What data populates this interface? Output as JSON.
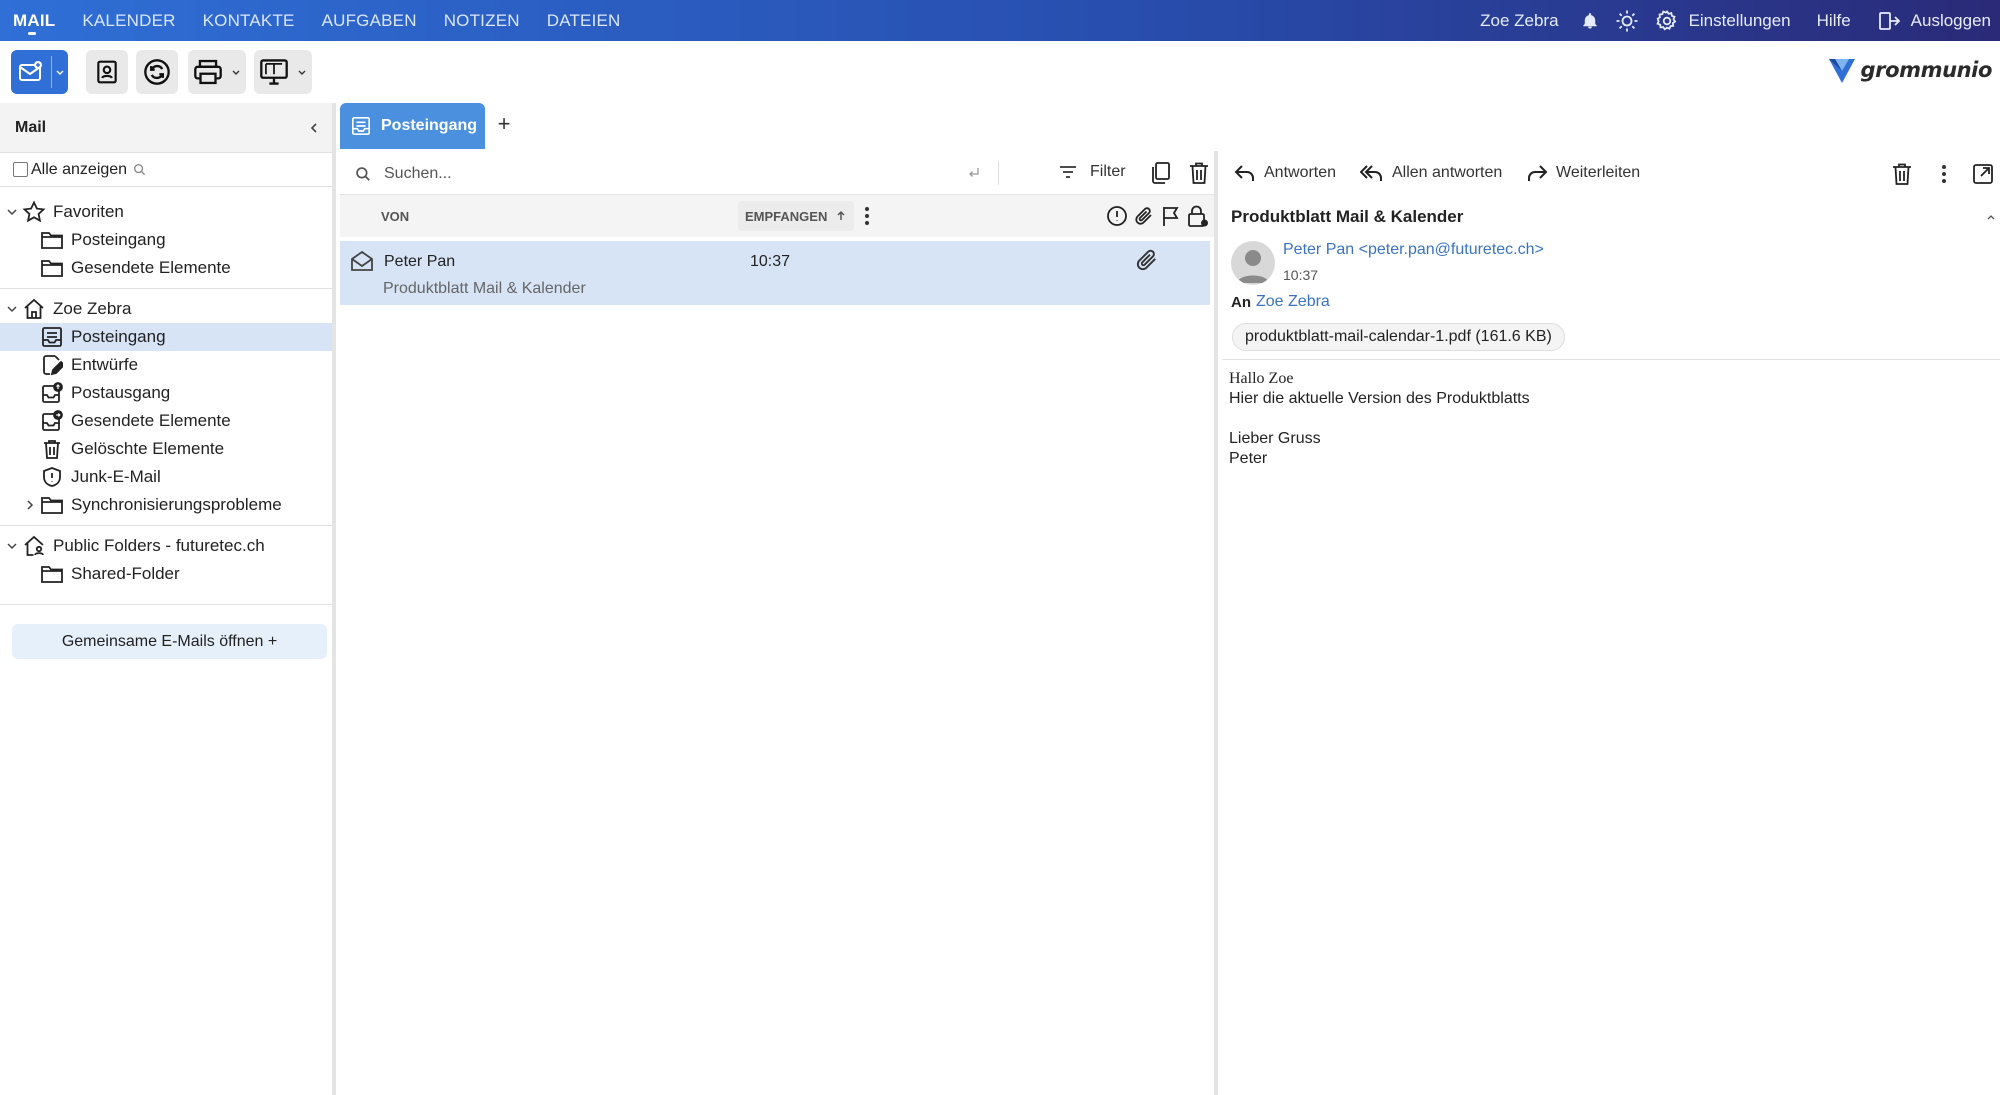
{
  "nav": {
    "items": [
      "MAIL",
      "KALENDER",
      "KONTAKTE",
      "AUFGABEN",
      "NOTIZEN",
      "DATEIEN"
    ],
    "user": "Zoe Zebra",
    "settings": "Einstellungen",
    "help": "Hilfe",
    "logout": "Ausloggen"
  },
  "brand": {
    "logo_text": "grommunio"
  },
  "sidebar": {
    "title": "Mail",
    "show_all": "Alle anzeigen",
    "favorites": {
      "label": "Favoriten",
      "items": [
        "Posteingang",
        "Gesendete Elemente"
      ]
    },
    "mailbox": {
      "label": "Zoe Zebra",
      "items": [
        "Posteingang",
        "Entwürfe",
        "Postausgang",
        "Gesendete Elemente",
        "Gelöschte Elemente",
        "Junk-E-Mail",
        "Synchronisierungsprobleme"
      ]
    },
    "public": {
      "label": "Public Folders - futuretec.ch",
      "items": [
        "Shared-Folder"
      ]
    },
    "shared_button": "Gemeinsame E-Mails öffnen +"
  },
  "tabs": {
    "active": "Posteingang",
    "add": "+"
  },
  "list": {
    "search_placeholder": "Suchen...",
    "filter": "Filter",
    "col_from": "VON",
    "col_received": "EMPFANGEN",
    "messages": [
      {
        "from": "Peter Pan",
        "subject": "Produktblatt Mail & Kalender",
        "time": "10:37"
      }
    ]
  },
  "reader": {
    "reply": "Antworten",
    "reply_all": "Allen antworten",
    "forward": "Weiterleiten",
    "subject": "Produktblatt Mail & Kalender",
    "sender": "Peter Pan <peter.pan@futuretec.ch>",
    "time": "10:37",
    "to_label": "An",
    "to": "Zoe Zebra",
    "attachment": "produktblatt-mail-calendar-1.pdf (161.6 KB)",
    "body": [
      "Hallo Zoe",
      "Hier die aktuelle Version des Produktblatts",
      "Lieber Gruss",
      "Peter"
    ]
  },
  "colors": {
    "nav_start": "#2f6fd6",
    "nav_end": "#2a2a78",
    "accent": "#4a90df",
    "selection": "#d6e4f6",
    "link": "#3a73c6"
  }
}
